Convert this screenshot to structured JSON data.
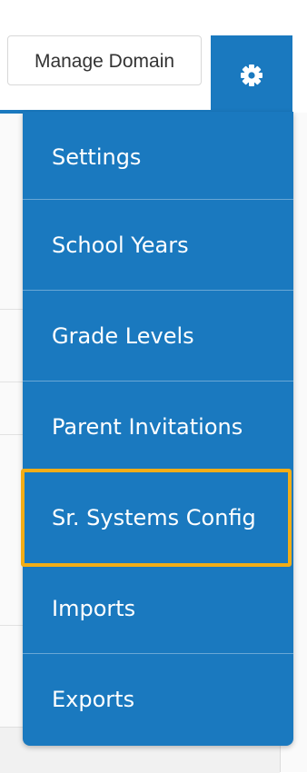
{
  "header": {
    "manage_domain_label": "Manage Domain",
    "settings_icon": "gear-icon",
    "accent_color": "#1a79bf"
  },
  "dropdown": {
    "items": [
      {
        "label": "Settings"
      },
      {
        "label": "School Years"
      },
      {
        "label": "Grade Levels"
      },
      {
        "label": "Parent Invitations"
      },
      {
        "label": "Sr. Systems Config",
        "focused": true
      },
      {
        "label": "Imports"
      },
      {
        "label": "Exports"
      }
    ],
    "focus_color": "#f2ad16"
  }
}
